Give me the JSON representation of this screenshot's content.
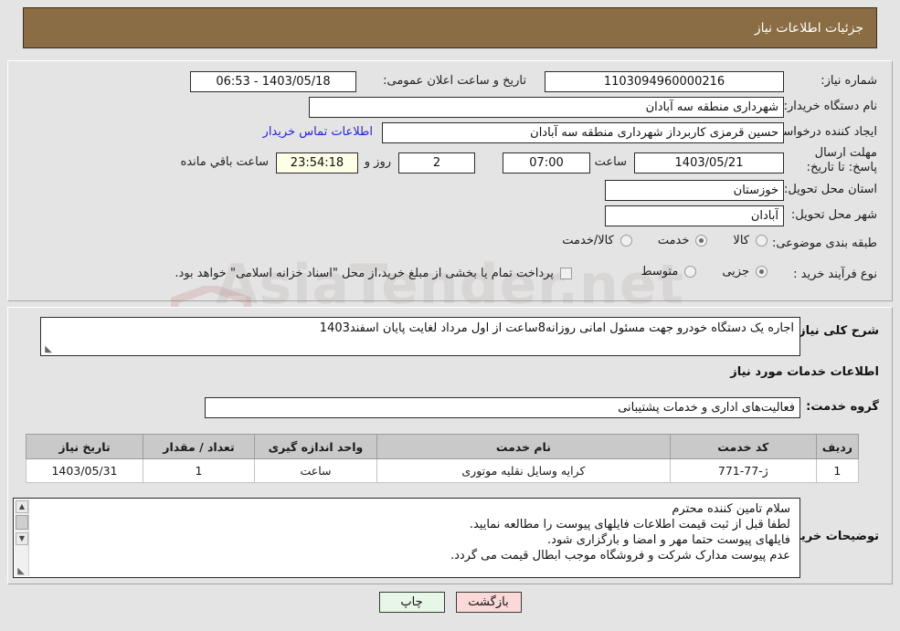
{
  "header": {
    "title": "جزئیات اطلاعات نیاز"
  },
  "watermark": {
    "text": "AsiaTender.net"
  },
  "info": {
    "need_number_label": "شماره نیاز:",
    "need_number_value": "1103094960000216",
    "announce_datetime_label": "تاریخ و ساعت اعلان عمومی:",
    "announce_datetime_value": "1403/05/18 - 06:53",
    "buyer_org_label": "نام دستگاه خریدار:",
    "buyer_org_value": "شهرداری منطقه سه آبادان",
    "creator_label": "ایجاد کننده درخواست:",
    "creator_value": "حسین قرمزی کاربرداز شهرداری منطقه سه آبادان",
    "contact_link": "اطلاعات تماس خریدار",
    "deadline_label": "مهلت ارسال پاسخ: تا تاریخ:",
    "deadline_date": "1403/05/21",
    "hour_label": "ساعت",
    "deadline_time": "07:00",
    "days_value": "2",
    "days_label": "روز و",
    "countdown_value": "23:54:18",
    "countdown_label": "ساعت باقي مانده",
    "province_label": "استان محل تحویل:",
    "province_value": "خوزستان",
    "city_label": "شهر محل تحویل:",
    "city_value": "آبادان",
    "category_label": "طبقه بندی موضوعی:",
    "category_options": [
      {
        "label": "کالا",
        "selected": false
      },
      {
        "label": "خدمت",
        "selected": true
      },
      {
        "label": "کالا/خدمت",
        "selected": false
      }
    ],
    "process_label": "نوع فرآیند خرید :",
    "process_options": [
      {
        "label": "جزیی",
        "selected": true
      },
      {
        "label": "متوسط",
        "selected": false
      }
    ],
    "treasury_checkbox_text": "پرداخت تمام یا بخشی از مبلغ خرید،از محل \"اسناد خزانه اسلامی\" خواهد بود.",
    "treasury_checked": false
  },
  "detail": {
    "summary_label": "شرح کلی نیاز:",
    "summary_value": "اجاره یک دستگاه خودرو جهت مسئول امانی روزانه8ساعت از اول مرداد لغایت پایان اسفند1403",
    "services_heading": "اطلاعات خدمات مورد نیاز",
    "service_group_label": "گروه خدمت:",
    "service_group_value": "فعالیت‌های اداری و خدمات پشتیبانی",
    "buyer_notes_label": "توضیحات خریدار:",
    "buyer_notes_lines": [
      "سلام تامین کننده محترم",
      "لطفا قبل از ثبت قیمت اطلاعات فایلهای پیوست را مطالعه نمایید.",
      "فایلهای پیوست حتما مهر و امضا و بارگزاری شود.",
      "عدم پیوست مدارک شرکت و فروشگاه موجب ابطال قیمت می گردد."
    ]
  },
  "table": {
    "columns": [
      "ردیف",
      "کد خدمت",
      "نام خدمت",
      "واحد اندازه گیری",
      "تعداد / مقدار",
      "تاریخ نیاز"
    ],
    "rows": [
      {
        "row_no": "1",
        "service_code": "ژ-77-771",
        "service_name": "کرایه وسایل نقلیه موتوری",
        "unit": "ساعت",
        "quantity": "1",
        "need_date": "1403/05/31"
      }
    ]
  },
  "buttons": {
    "print": "چاپ",
    "back": "بازگشت"
  },
  "colors": {
    "header_bg": "#8a6d44",
    "page_bg": "#e4e4e4",
    "link": "#2424dd",
    "timer_bg": "#feffe6",
    "print_btn_bg": "#e8f6e8",
    "back_btn_bg": "#fcd9d9",
    "table_header_bg": "#c9c9c9"
  }
}
